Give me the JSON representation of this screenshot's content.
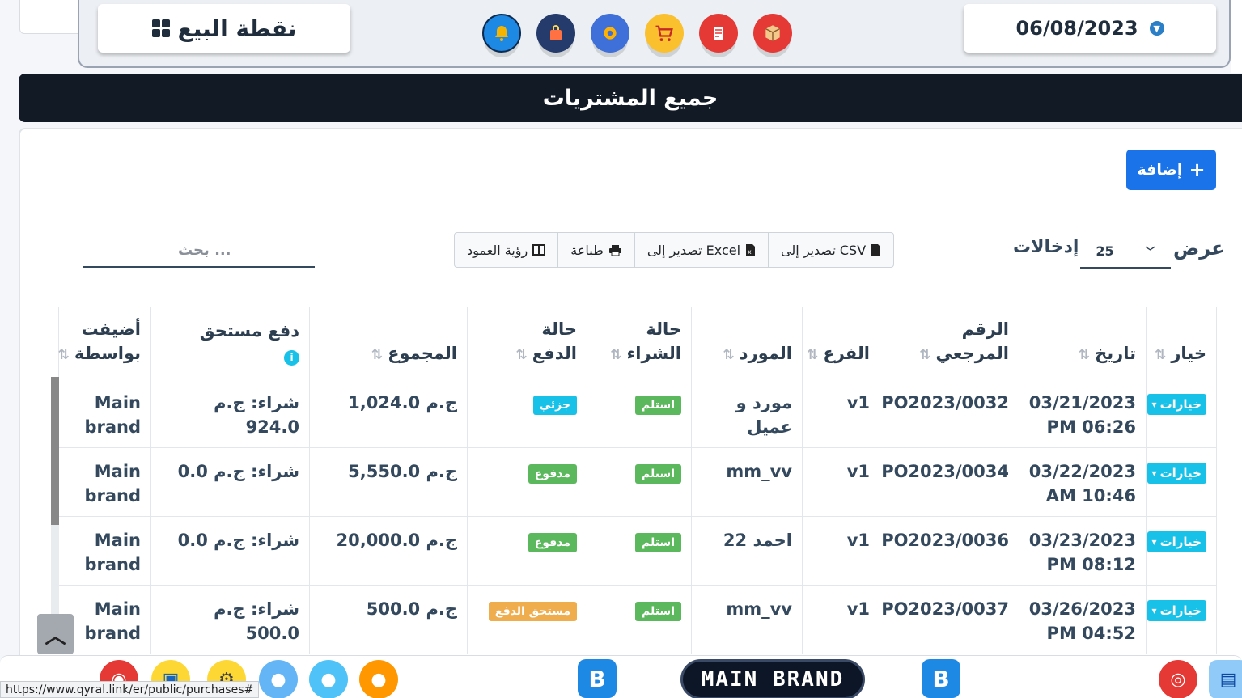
{
  "header": {
    "pos_label": "نقطة البيع",
    "date": "06/08/2023",
    "icons": [
      "bell-icon",
      "shopping-bag-icon",
      "settings-gear-icon",
      "cart-icon",
      "invoice-icon",
      "box-icon"
    ]
  },
  "page_title": "جميع المشتريات",
  "toolbar": {
    "add_label": "إضافة",
    "show_label": "عرض",
    "entries_value": "25",
    "entries_label": "إدخالات",
    "export_csv": "تصدير إلى CSV",
    "export_excel": "تصدير إلى Excel",
    "print": "طباعة",
    "column_visibility": "رؤية العمود",
    "search_placeholder": "بحث ..."
  },
  "table": {
    "headers": {
      "action": "خيار",
      "date": "تاريخ",
      "ref_no": "الرقم المرجعي",
      "branch": "الفرع",
      "supplier": "المورد",
      "purchase_status": "حالة الشراء",
      "payment_status": "حالة الدفع",
      "total": "المجموع",
      "payment_due": "دفع مستحق",
      "added_by": "أضيفت بواسطة"
    },
    "rows": [
      {
        "action": "خيارات",
        "date": "03/21/2023 PM 06:26",
        "ref_no": "PO2023/0032",
        "branch": "v1",
        "supplier": "مورد و عميل",
        "purchase_status": "استلم",
        "payment_status": "جزئي",
        "payment_color": "cyan",
        "total": "ج.م 1,024.0",
        "payment_due": "شراء: ج.م 924.0",
        "added_by": "Main brand"
      },
      {
        "action": "خيارات",
        "date": "03/22/2023 AM 10:46",
        "ref_no": "PO2023/0034",
        "branch": "v1",
        "supplier": "mm_vv",
        "purchase_status": "استلم",
        "payment_status": "مدفوع",
        "payment_color": "green",
        "total": "ج.م 5,550.0",
        "payment_due": "شراء: ج.م 0.0",
        "added_by": "Main brand"
      },
      {
        "action": "خيارات",
        "date": "03/23/2023 PM 08:12",
        "ref_no": "PO2023/0036",
        "branch": "v1",
        "supplier": "احمد 22",
        "purchase_status": "استلم",
        "payment_status": "مدفوع",
        "payment_color": "green",
        "total": "ج.م 20,000.0",
        "payment_due": "شراء: ج.م 0.0",
        "added_by": "Main brand"
      },
      {
        "action": "خيارات",
        "date": "03/26/2023 PM 04:52",
        "ref_no": "PO2023/0037",
        "branch": "v1",
        "supplier": "mm_vv",
        "purchase_status": "استلم",
        "payment_status": "مستحق الدفع",
        "payment_color": "orange",
        "total": "ج.م 500.0",
        "payment_due": "شراء: ج.م 500.0",
        "added_by": "Main brand"
      }
    ]
  },
  "bottom": {
    "brand_label": "MAIN BRAND",
    "b_letter": "B",
    "status_url": "https://www.qyral.link/er/public/purchases#"
  },
  "colors": {
    "title_bar": "#121a26",
    "add_button": "#1a73e8",
    "badge_green": "#5cb85c",
    "badge_cyan": "#17c1e8",
    "badge_orange": "#f0ad4e"
  }
}
